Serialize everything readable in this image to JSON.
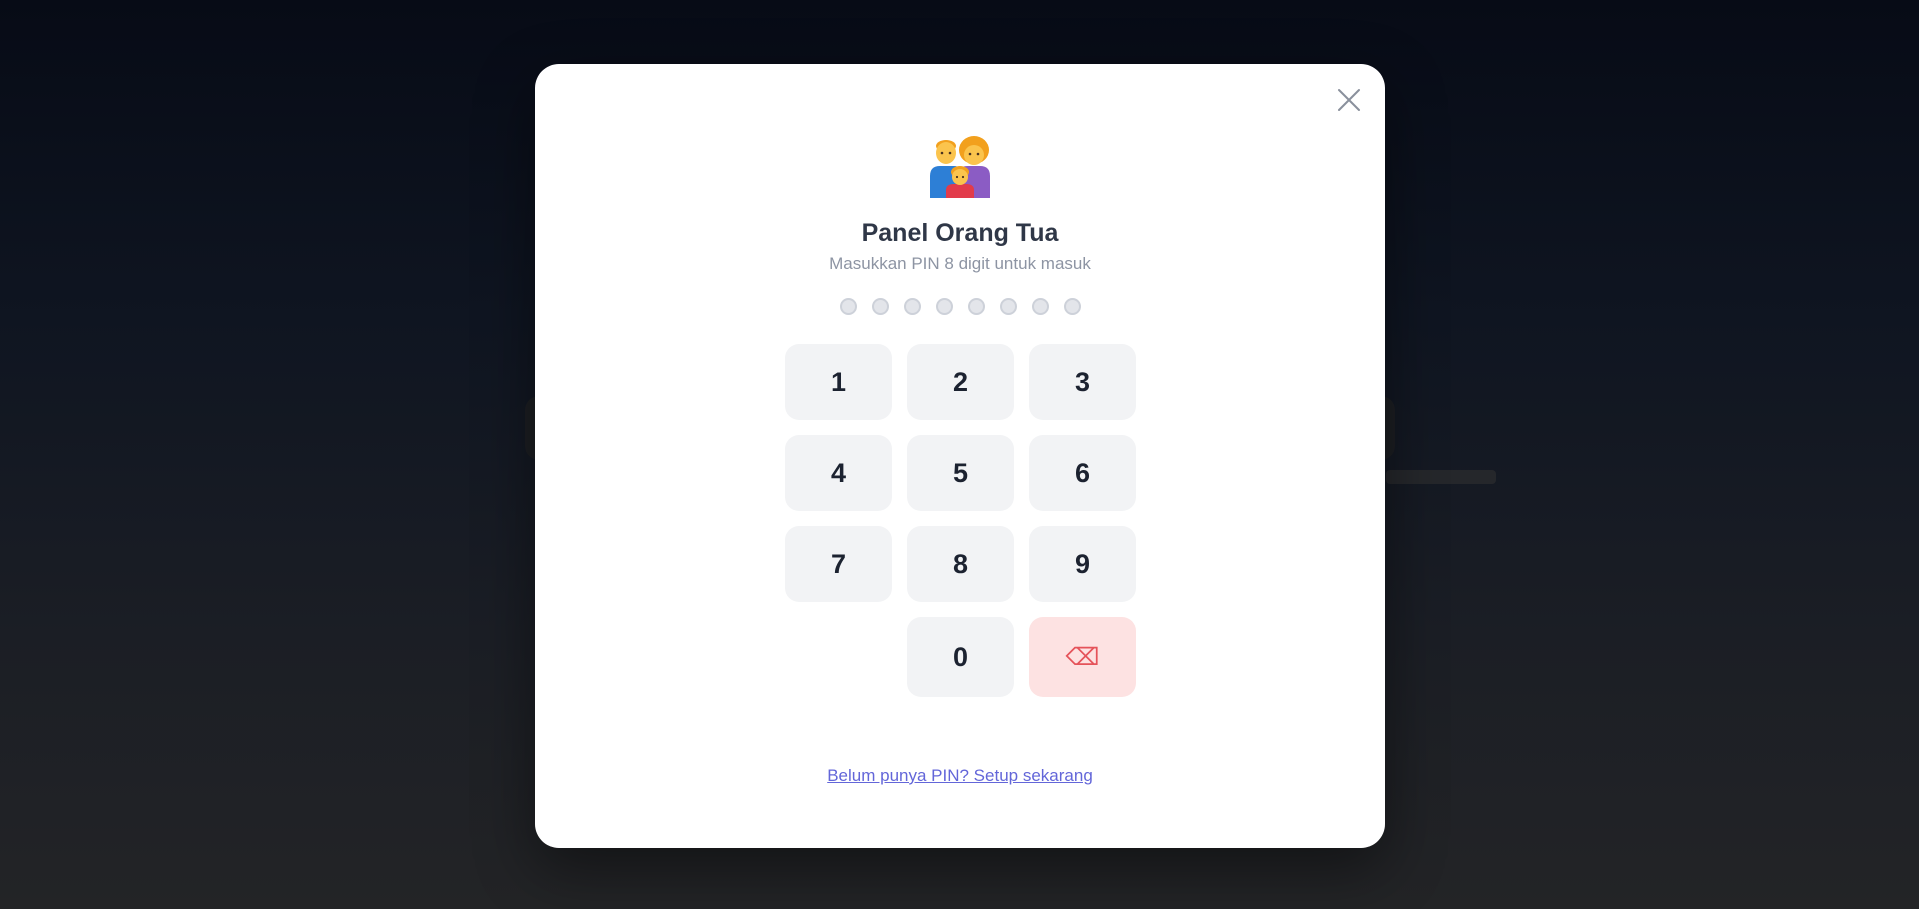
{
  "modal": {
    "title": "Panel Orang Tua",
    "subtitle": "Masukkan PIN 8 digit untuk masuk",
    "header_icon": "family-icon",
    "close_icon": "close-icon"
  },
  "pin": {
    "length": 8,
    "filled": 0
  },
  "keypad": {
    "k1": "1",
    "k2": "2",
    "k3": "3",
    "k4": "4",
    "k5": "5",
    "k6": "6",
    "k7": "7",
    "k8": "8",
    "k9": "9",
    "k0": "0",
    "backspace": "⌫"
  },
  "footer": {
    "setup_link": "Belum punya PIN? Setup sekarang"
  },
  "colors": {
    "accent_link": "#6366d9",
    "backspace_bg": "#fde2e2",
    "backspace_fg": "#e5535a",
    "key_bg": "#f2f3f5"
  }
}
